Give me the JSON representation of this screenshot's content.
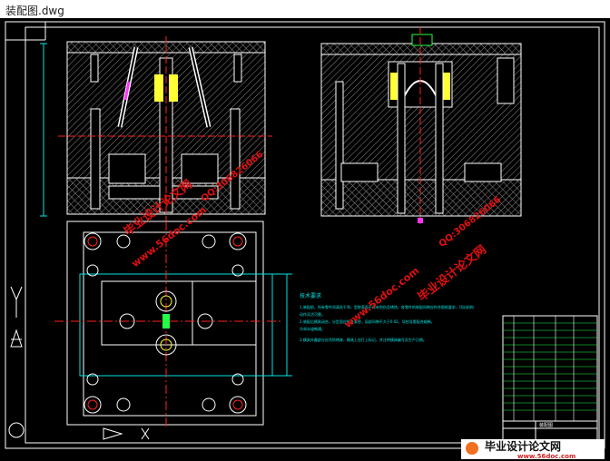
{
  "window": {
    "title": "装配图.dwg"
  },
  "colors": {
    "background": "#000000",
    "frame": "#ffffff",
    "hatch": "#9a9a9a",
    "cyan": "#00e5e5",
    "red": "#ff2020",
    "yellow": "#ffff33",
    "green": "#22ff44",
    "magenta": "#ff33ff",
    "watermark": "#e01010"
  },
  "watermarks": {
    "brand_cn": "毕业设计论文网",
    "url": "www.56doc.com",
    "qq": "QQ:306826066"
  },
  "notes": {
    "title": "技术要求",
    "lines": [
      "1.装配前，所有零件须清洗干净，型腔表面不得有划伤及锈蚀，各零件的装配间隙应符合图纸要求，顶出机构",
      "动作灵活可靠。",
      "2.装配后模具闭合，分型面应贴合紧密，局部间隙不大于0.02，导柱导套配合顺畅，",
      "冷却水道畅通。",
      "3.模具外露部分应涂防锈漆，模具上应打上标记，并注明模具编号及生产日期。"
    ]
  },
  "title_block": {
    "drawing_name": "装配图"
  },
  "footer_logo": {
    "text": "毕业设计论文网",
    "url": "www.56doc.com"
  }
}
